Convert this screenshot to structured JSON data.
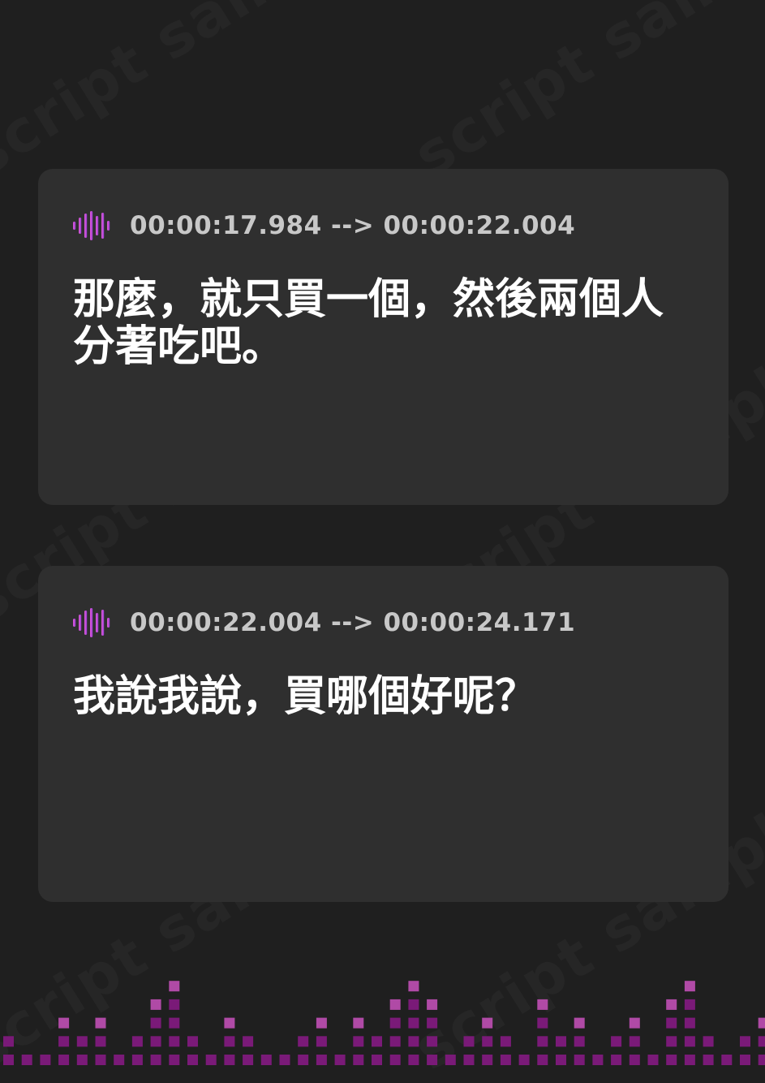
{
  "watermark": {
    "text": "script sample"
  },
  "cues": [
    {
      "timecode": "00:00:17.984 --> 00:00:22.004",
      "text": "那麼，就只買一個，然後兩個人分著吃吧。",
      "icon": "audio-waveform-icon"
    },
    {
      "timecode": "00:00:22.004 --> 00:00:24.171",
      "text": "我說我說，買哪個好呢？",
      "icon": "audio-waveform-icon"
    }
  ],
  "colors": {
    "background": "#1f1f1f",
    "card": "#2f2f2f",
    "timecode": "#c8c8c8",
    "subtitle": "#ffffff",
    "accent_pink": "#e05ad6",
    "accent_purple": "#9b3fd6",
    "equalizer_dim": "#7a1a78",
    "equalizer_bright": "#b04aa6"
  },
  "equalizer": {
    "levels": [
      2,
      1,
      1,
      3,
      2,
      3,
      1,
      2,
      4,
      5,
      2,
      1,
      3,
      2,
      1,
      1,
      2,
      3,
      1,
      3,
      2,
      4,
      5,
      4,
      1,
      2,
      3,
      2,
      1,
      4,
      2,
      3,
      1,
      2,
      3,
      1,
      4,
      5,
      2,
      1,
      2,
      3,
      1,
      1,
      2,
      2,
      1
    ]
  }
}
